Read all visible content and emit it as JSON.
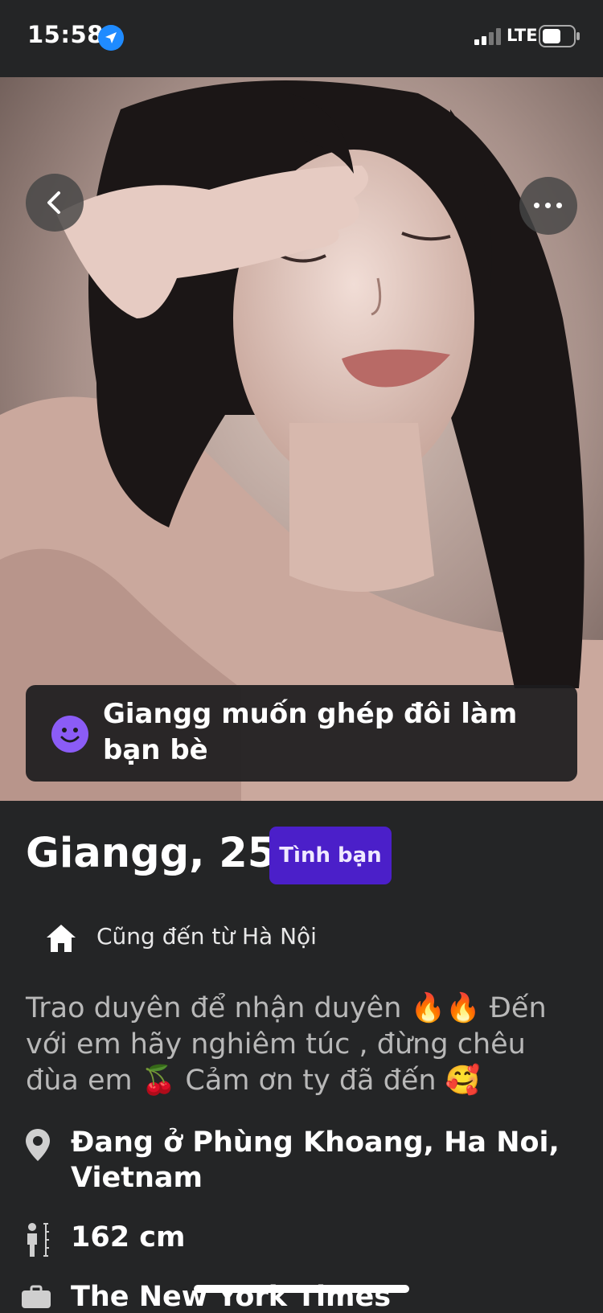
{
  "status_bar": {
    "time": "15:58",
    "network": "LTE",
    "icons": [
      "location-arrow-icon",
      "signal-bars-icon",
      "battery-icon"
    ]
  },
  "photo": {
    "icons": [
      "back-chevron-icon",
      "more-dots-icon"
    ]
  },
  "match_banner": {
    "icon": "smile-icon",
    "text": "Giangg muốn ghép đôi làm bạn bè",
    "accent_color": "#8b5cf6"
  },
  "profile": {
    "name_age": "Giangg, 25",
    "tag": "Tình bạn",
    "tag_color": "#4b1fc9",
    "hometown": "Cũng đến từ Hà Nội",
    "bio": "Trao duyên để nhận duyên 🔥🔥 Đến với em hãy nghiêm túc , đừng chêu đùa em 🍒 Cảm ơn ty đã đến 🥰",
    "location": "Đang ở Phùng Khoang, Ha Noi, Vietnam",
    "height": "162 cm",
    "job": "The New York Times"
  }
}
